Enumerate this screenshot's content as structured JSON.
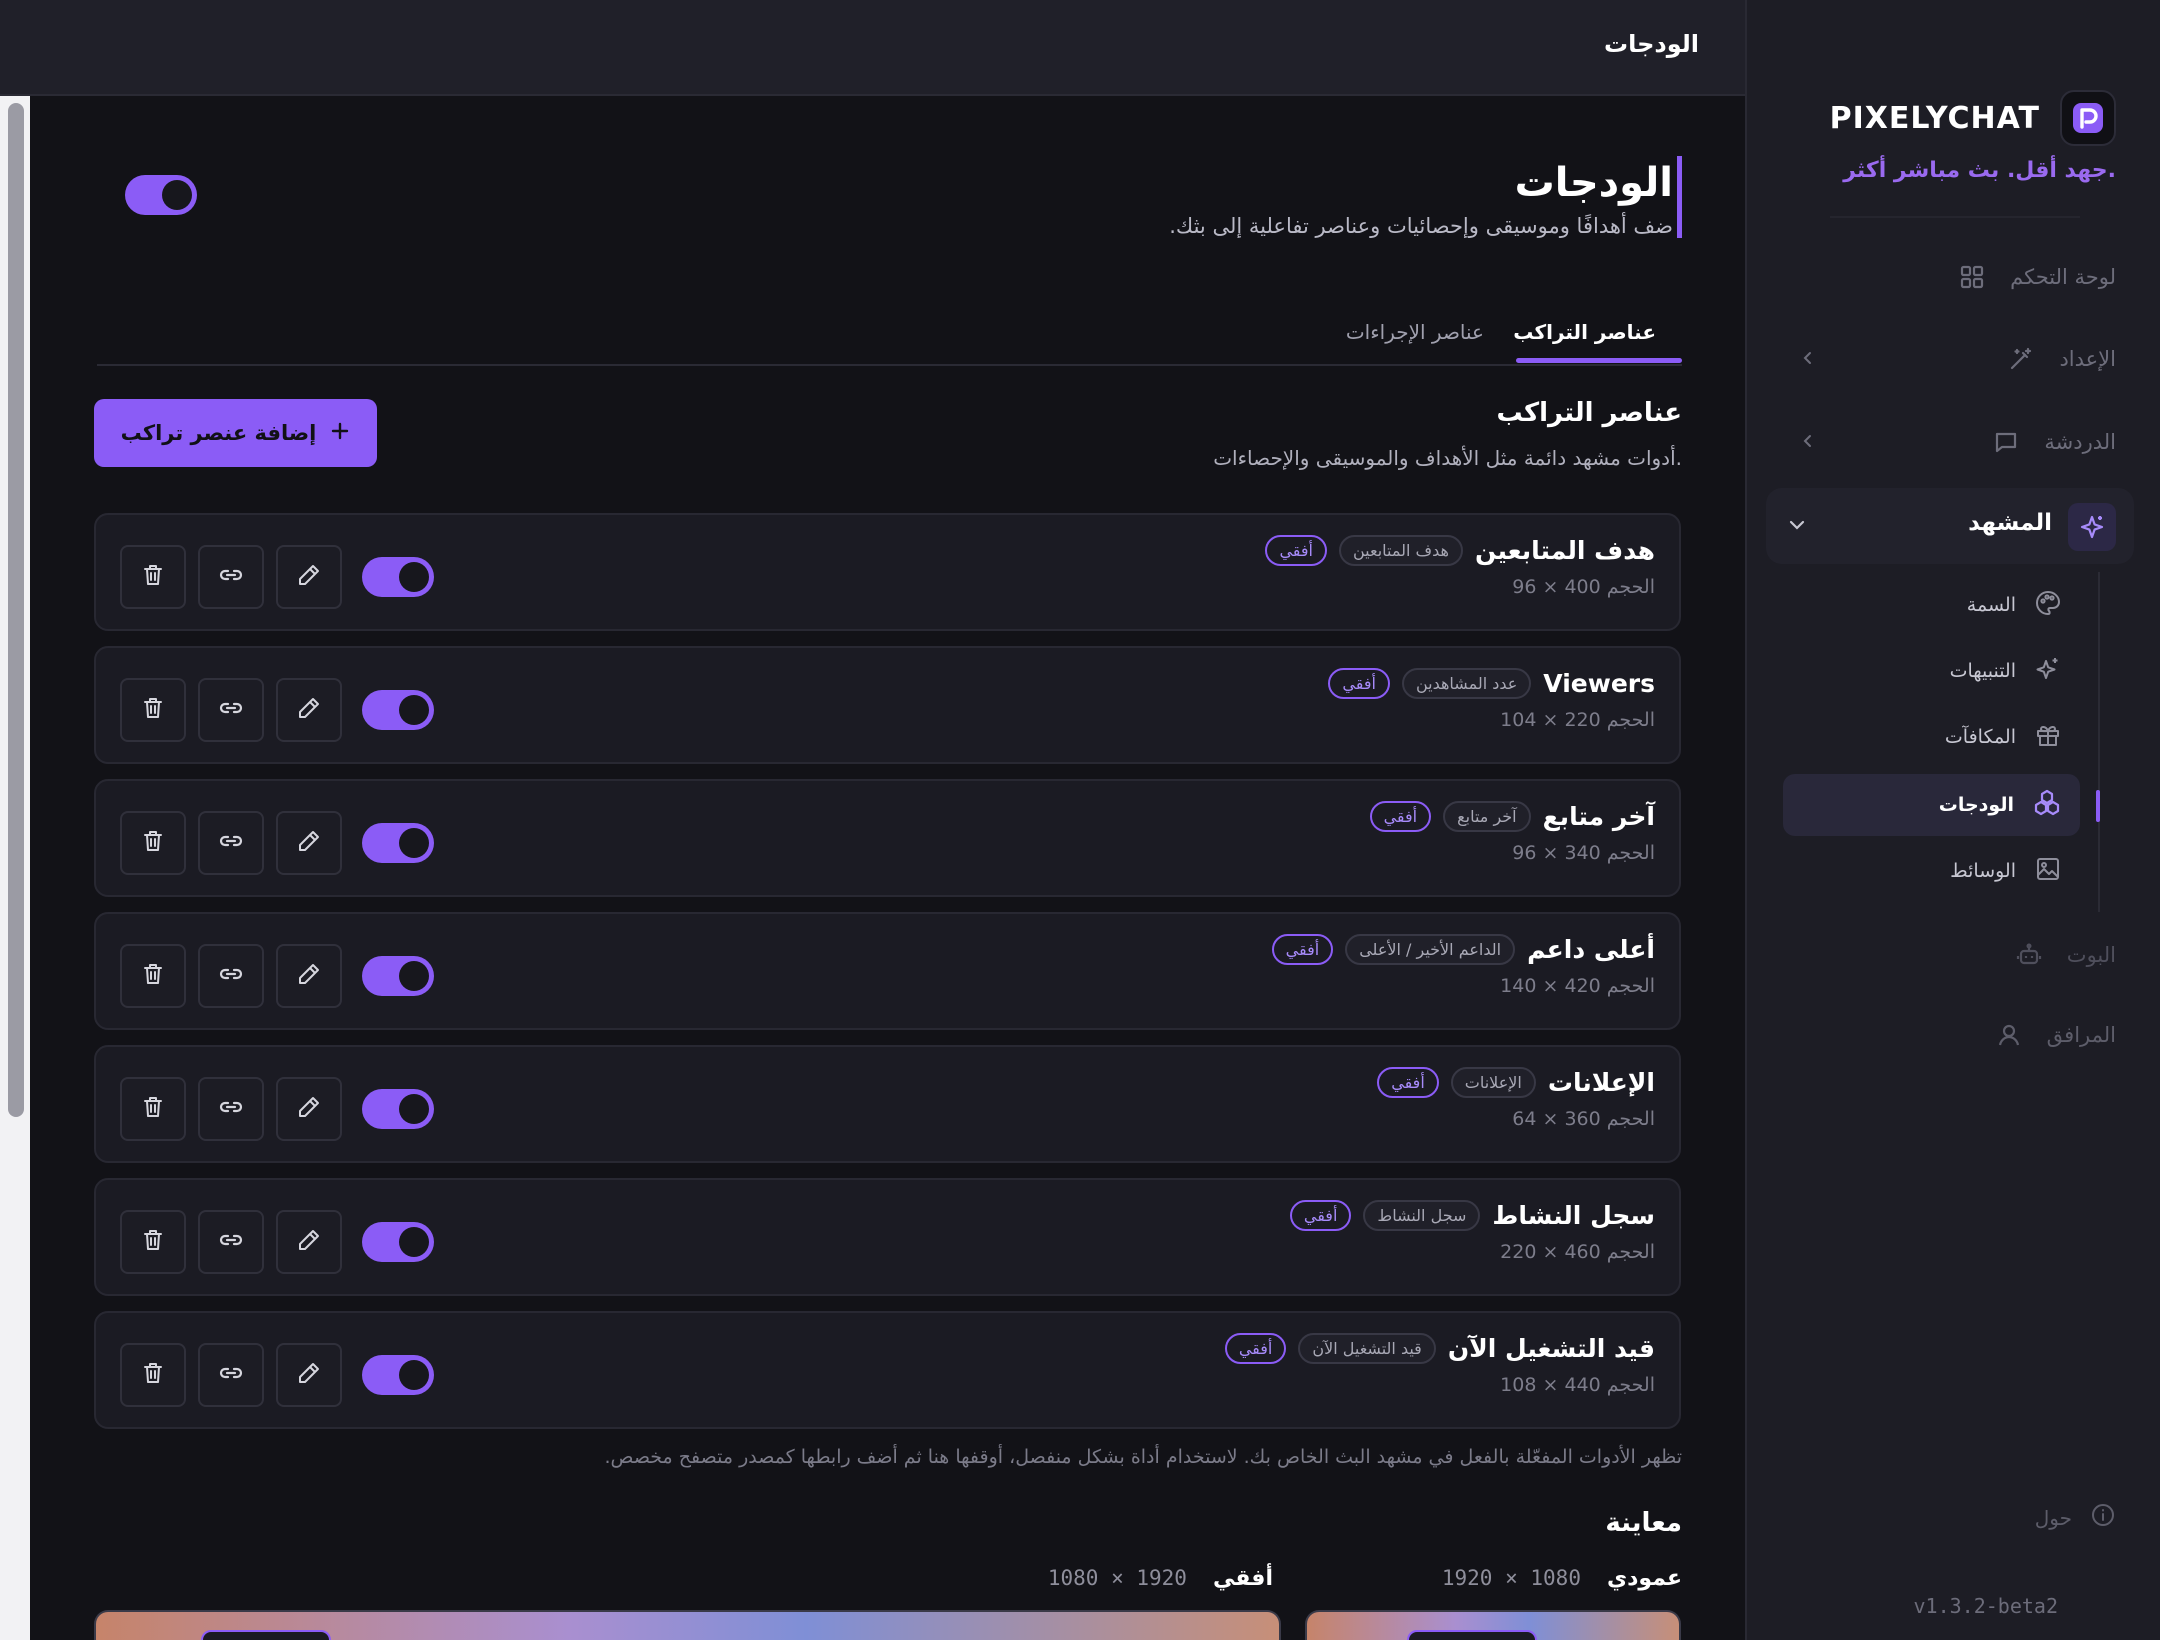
{
  "app": {
    "brand": "PIXELYCHAT",
    "tagline": "جهد أقل. بث مباشر أكثر.",
    "version": "v1.3.2-beta2",
    "accent": "#8b5cf6"
  },
  "topbar": {
    "title": "الودجات"
  },
  "sidebar": {
    "items": [
      {
        "label": "لوحة التحكم",
        "icon": "grid-icon"
      },
      {
        "label": "الإعداد",
        "icon": "wand-icon"
      },
      {
        "label": "الدردشة",
        "icon": "chat-icon"
      },
      {
        "label": "المشهد",
        "icon": "sparkle-icon"
      },
      {
        "label": "البوت",
        "icon": "bot-icon"
      },
      {
        "label": "المرافق",
        "icon": "user-icon"
      }
    ],
    "scene_sub": [
      {
        "label": "السمة",
        "icon": "palette-icon"
      },
      {
        "label": "التنبيهات",
        "icon": "sparkles-icon"
      },
      {
        "label": "المكافآت",
        "icon": "gift-icon"
      },
      {
        "label": "الودجات",
        "icon": "widgets-icon"
      },
      {
        "label": "الوسائط",
        "icon": "image-icon"
      }
    ],
    "about": "حول"
  },
  "page": {
    "title": "الودجات",
    "subtitle": "ضف أهدافًا وموسيقى وإحصائيات وعناصر تفاعلية إلى بثك.",
    "master_toggle": true
  },
  "tabs": {
    "overlay": "عناصر التراكب",
    "actions": "عناصر الإجراءات"
  },
  "section": {
    "title": "عناصر التراكب",
    "subtitle": "أدوات مشهد دائمة مثل الأهداف والموسيقى والإحصاءات.",
    "add_button": "إضافة عنصر تراكب"
  },
  "widgets": [
    {
      "name": "هدف المتابعين",
      "type": "هدف المتابعين",
      "orientation": "أفقي",
      "size": "الحجم 400 × 96",
      "enabled": true
    },
    {
      "name": "Viewers",
      "type": "عدد المشاهدين",
      "orientation": "أفقي",
      "size": "الحجم 220 × 104",
      "enabled": true
    },
    {
      "name": "آخر متابع",
      "type": "آخر متابع",
      "orientation": "أفقي",
      "size": "الحجم 340 × 96",
      "enabled": true
    },
    {
      "name": "أعلى داعم",
      "type": "الداعم الأخير / الأعلى",
      "orientation": "أفقي",
      "size": "الحجم 420 × 140",
      "enabled": true
    },
    {
      "name": "الإعلانات",
      "type": "الإعلانات",
      "orientation": "أفقي",
      "size": "الحجم 360 × 64",
      "enabled": true
    },
    {
      "name": "سجل النشاط",
      "type": "سجل النشاط",
      "orientation": "أفقي",
      "size": "الحجم 460 × 220",
      "enabled": true
    },
    {
      "name": "قيد التشغيل الآن",
      "type": "قيد التشغيل الآن",
      "orientation": "أفقي",
      "size": "الحجم 440 × 108",
      "enabled": true
    }
  ],
  "note": "تظهر الأدوات المفعّلة بالفعل في مشهد البث الخاص بك. لاستخدام أداة بشكل منفصل، أوقفها هنا ثم أضف رابطها كمصدر متصفح مخصص.",
  "preview": {
    "title": "معاينة",
    "vertical": {
      "label": "عمودي",
      "dims": "1080 × 1920"
    },
    "horizontal": {
      "label": "أفقي",
      "dims": "1920 × 1080"
    }
  }
}
